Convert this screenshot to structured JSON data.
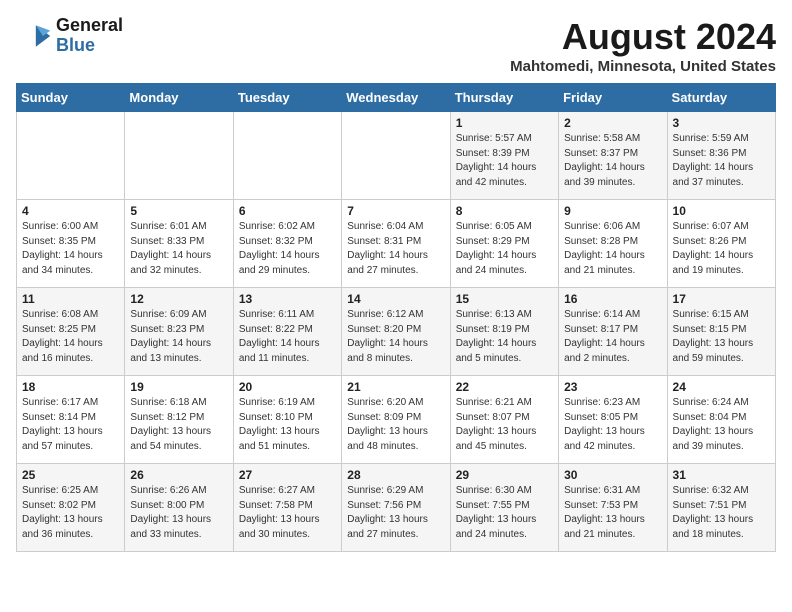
{
  "header": {
    "logo_line1": "General",
    "logo_line2": "Blue",
    "month_year": "August 2024",
    "location": "Mahtomedi, Minnesota, United States"
  },
  "days_of_week": [
    "Sunday",
    "Monday",
    "Tuesday",
    "Wednesday",
    "Thursday",
    "Friday",
    "Saturday"
  ],
  "weeks": [
    [
      {
        "day": "",
        "info": ""
      },
      {
        "day": "",
        "info": ""
      },
      {
        "day": "",
        "info": ""
      },
      {
        "day": "",
        "info": ""
      },
      {
        "day": "1",
        "info": "Sunrise: 5:57 AM\nSunset: 8:39 PM\nDaylight: 14 hours\nand 42 minutes."
      },
      {
        "day": "2",
        "info": "Sunrise: 5:58 AM\nSunset: 8:37 PM\nDaylight: 14 hours\nand 39 minutes."
      },
      {
        "day": "3",
        "info": "Sunrise: 5:59 AM\nSunset: 8:36 PM\nDaylight: 14 hours\nand 37 minutes."
      }
    ],
    [
      {
        "day": "4",
        "info": "Sunrise: 6:00 AM\nSunset: 8:35 PM\nDaylight: 14 hours\nand 34 minutes."
      },
      {
        "day": "5",
        "info": "Sunrise: 6:01 AM\nSunset: 8:33 PM\nDaylight: 14 hours\nand 32 minutes."
      },
      {
        "day": "6",
        "info": "Sunrise: 6:02 AM\nSunset: 8:32 PM\nDaylight: 14 hours\nand 29 minutes."
      },
      {
        "day": "7",
        "info": "Sunrise: 6:04 AM\nSunset: 8:31 PM\nDaylight: 14 hours\nand 27 minutes."
      },
      {
        "day": "8",
        "info": "Sunrise: 6:05 AM\nSunset: 8:29 PM\nDaylight: 14 hours\nand 24 minutes."
      },
      {
        "day": "9",
        "info": "Sunrise: 6:06 AM\nSunset: 8:28 PM\nDaylight: 14 hours\nand 21 minutes."
      },
      {
        "day": "10",
        "info": "Sunrise: 6:07 AM\nSunset: 8:26 PM\nDaylight: 14 hours\nand 19 minutes."
      }
    ],
    [
      {
        "day": "11",
        "info": "Sunrise: 6:08 AM\nSunset: 8:25 PM\nDaylight: 14 hours\nand 16 minutes."
      },
      {
        "day": "12",
        "info": "Sunrise: 6:09 AM\nSunset: 8:23 PM\nDaylight: 14 hours\nand 13 minutes."
      },
      {
        "day": "13",
        "info": "Sunrise: 6:11 AM\nSunset: 8:22 PM\nDaylight: 14 hours\nand 11 minutes."
      },
      {
        "day": "14",
        "info": "Sunrise: 6:12 AM\nSunset: 8:20 PM\nDaylight: 14 hours\nand 8 minutes."
      },
      {
        "day": "15",
        "info": "Sunrise: 6:13 AM\nSunset: 8:19 PM\nDaylight: 14 hours\nand 5 minutes."
      },
      {
        "day": "16",
        "info": "Sunrise: 6:14 AM\nSunset: 8:17 PM\nDaylight: 14 hours\nand 2 minutes."
      },
      {
        "day": "17",
        "info": "Sunrise: 6:15 AM\nSunset: 8:15 PM\nDaylight: 13 hours\nand 59 minutes."
      }
    ],
    [
      {
        "day": "18",
        "info": "Sunrise: 6:17 AM\nSunset: 8:14 PM\nDaylight: 13 hours\nand 57 minutes."
      },
      {
        "day": "19",
        "info": "Sunrise: 6:18 AM\nSunset: 8:12 PM\nDaylight: 13 hours\nand 54 minutes."
      },
      {
        "day": "20",
        "info": "Sunrise: 6:19 AM\nSunset: 8:10 PM\nDaylight: 13 hours\nand 51 minutes."
      },
      {
        "day": "21",
        "info": "Sunrise: 6:20 AM\nSunset: 8:09 PM\nDaylight: 13 hours\nand 48 minutes."
      },
      {
        "day": "22",
        "info": "Sunrise: 6:21 AM\nSunset: 8:07 PM\nDaylight: 13 hours\nand 45 minutes."
      },
      {
        "day": "23",
        "info": "Sunrise: 6:23 AM\nSunset: 8:05 PM\nDaylight: 13 hours\nand 42 minutes."
      },
      {
        "day": "24",
        "info": "Sunrise: 6:24 AM\nSunset: 8:04 PM\nDaylight: 13 hours\nand 39 minutes."
      }
    ],
    [
      {
        "day": "25",
        "info": "Sunrise: 6:25 AM\nSunset: 8:02 PM\nDaylight: 13 hours\nand 36 minutes."
      },
      {
        "day": "26",
        "info": "Sunrise: 6:26 AM\nSunset: 8:00 PM\nDaylight: 13 hours\nand 33 minutes."
      },
      {
        "day": "27",
        "info": "Sunrise: 6:27 AM\nSunset: 7:58 PM\nDaylight: 13 hours\nand 30 minutes."
      },
      {
        "day": "28",
        "info": "Sunrise: 6:29 AM\nSunset: 7:56 PM\nDaylight: 13 hours\nand 27 minutes."
      },
      {
        "day": "29",
        "info": "Sunrise: 6:30 AM\nSunset: 7:55 PM\nDaylight: 13 hours\nand 24 minutes."
      },
      {
        "day": "30",
        "info": "Sunrise: 6:31 AM\nSunset: 7:53 PM\nDaylight: 13 hours\nand 21 minutes."
      },
      {
        "day": "31",
        "info": "Sunrise: 6:32 AM\nSunset: 7:51 PM\nDaylight: 13 hours\nand 18 minutes."
      }
    ]
  ]
}
